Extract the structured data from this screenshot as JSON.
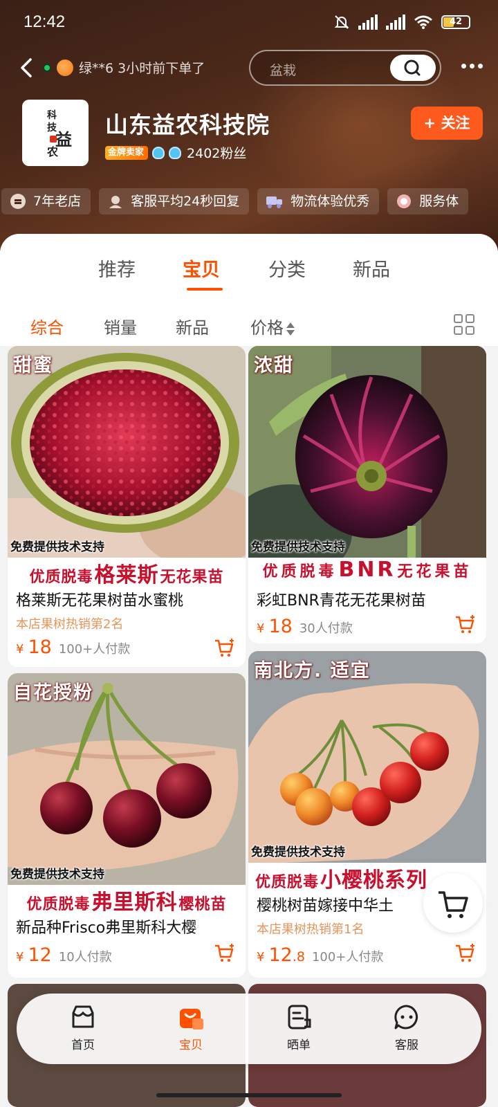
{
  "status_bar": {
    "time": "12:42",
    "battery": "42"
  },
  "nav": {
    "buyer_notice": "绿**6 3小时前下单了",
    "search_placeholder": "盆栽"
  },
  "store": {
    "name": "山东益农科技院",
    "logo_chars": [
      "科",
      "技",
      "益",
      "农"
    ],
    "gold_badge": "金牌卖家",
    "fans": "2402粉丝",
    "follow_label": "+ 关注"
  },
  "tags": [
    {
      "label": "7年老店",
      "icon": "store-age-icon"
    },
    {
      "label": "客服平均24秒回复",
      "icon": "customer-service-icon"
    },
    {
      "label": "物流体验优秀",
      "icon": "truck-icon"
    },
    {
      "label": "服务体",
      "icon": "service-icon"
    }
  ],
  "tabs": [
    {
      "label": "推荐",
      "active": false
    },
    {
      "label": "宝贝",
      "active": true
    },
    {
      "label": "分类",
      "active": false
    },
    {
      "label": "新品",
      "active": false
    }
  ],
  "sorts": [
    {
      "label": "综合",
      "active": true
    },
    {
      "label": "销量",
      "active": false
    },
    {
      "label": "新品",
      "active": false
    },
    {
      "label": "价格",
      "active": false
    }
  ],
  "products": [
    {
      "badge": "甜蜜",
      "support": "免费提供技术支持",
      "promo": [
        "优质脱毒",
        "格莱斯",
        "无花果苗"
      ],
      "title": "格莱斯无花果树苗水蜜桃",
      "rank": "本店果树热销第2名",
      "price": "18",
      "price_decimal": "",
      "paid": "100+人付款"
    },
    {
      "badge": "浓甜",
      "support": "免费提供技术支持",
      "promo": [
        "优质脱毒",
        "BNR",
        "无花果苗"
      ],
      "title": "彩虹BNR青花无花果树苗",
      "rank": "",
      "price": "18",
      "price_decimal": "",
      "paid": "30人付款"
    },
    {
      "badge": "自花授粉",
      "support": "免费提供技术支持",
      "promo": [
        "优质脱毒",
        "弗里斯科",
        "樱桃苗"
      ],
      "title": "新品种Frisco弗里斯科大樱",
      "rank": "",
      "price": "12",
      "price_decimal": "",
      "paid": "10人付款"
    },
    {
      "badge": "南北方. 适宜",
      "support": "免费提供技术支持",
      "promo": [
        "优质脱毒",
        "小樱桃系列",
        ""
      ],
      "title": "樱桃树苗嫁接中华土",
      "rank": "本店果树热销第1名",
      "price": "12",
      "price_decimal": ".8",
      "paid": "100+人付款"
    }
  ],
  "price_symbol": "¥",
  "bottom_nav": [
    {
      "label": "首页",
      "icon": "home-icon",
      "active": false
    },
    {
      "label": "宝贝",
      "icon": "bag-icon",
      "active": true
    },
    {
      "label": "晒单",
      "icon": "review-icon",
      "active": false
    },
    {
      "label": "客服",
      "icon": "chat-icon",
      "active": false
    }
  ],
  "colors": {
    "accent": "#ff5000",
    "header": "#4a2819",
    "promo_red": "#c8102e"
  }
}
